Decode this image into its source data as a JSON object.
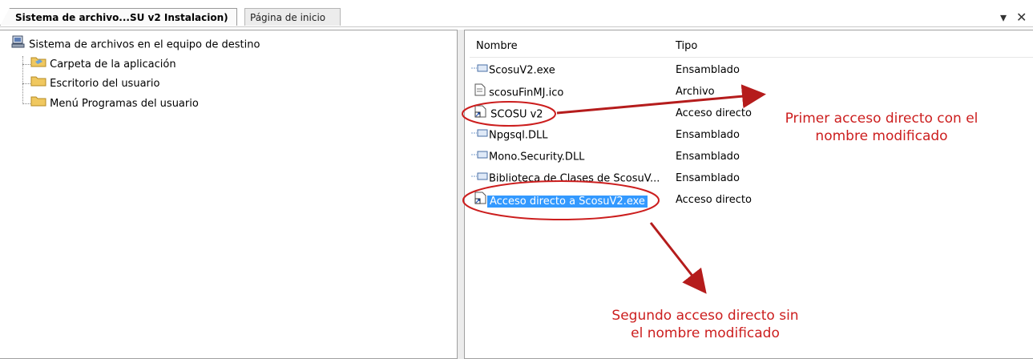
{
  "tabs": {
    "active": "Sistema de archivo...SU v2 Instalacion)",
    "inactive": "Página de inicio"
  },
  "tree": {
    "root": "Sistema de archivos en el equipo de destino",
    "folders": [
      "Carpeta de la aplicación",
      "Escritorio del usuario",
      "Menú Programas del usuario"
    ]
  },
  "list": {
    "columns": [
      "Nombre",
      "Tipo"
    ],
    "rows": [
      {
        "name": "ScosuV2.exe",
        "type": "Ensamblado",
        "icon": "assembly-icon"
      },
      {
        "name": "scosuFinMJ.ico",
        "type": "Archivo",
        "icon": "file-icon"
      },
      {
        "name": "SCOSU v2",
        "type": "Acceso directo",
        "icon": "shortcut-icon"
      },
      {
        "name": "Npgsql.DLL",
        "type": "Ensamblado",
        "icon": "assembly-icon"
      },
      {
        "name": "Mono.Security.DLL",
        "type": "Ensamblado",
        "icon": "assembly-icon"
      },
      {
        "name": "Biblioteca de Clases de ScosuV...",
        "type": "Ensamblado",
        "icon": "assembly-icon"
      },
      {
        "name": "Acceso directo a ScosuV2.exe",
        "type": "Acceso directo",
        "icon": "shortcut-icon",
        "selected": true
      }
    ]
  },
  "annotations": {
    "first_line1": "Primer acceso directo con el",
    "first_line2": "nombre modificado",
    "second_line1": "Segundo acceso directo sin",
    "second_line2": "el nombre modificado"
  },
  "colors": {
    "annotation": "#cc1e1e",
    "selection": "#3399ff"
  }
}
